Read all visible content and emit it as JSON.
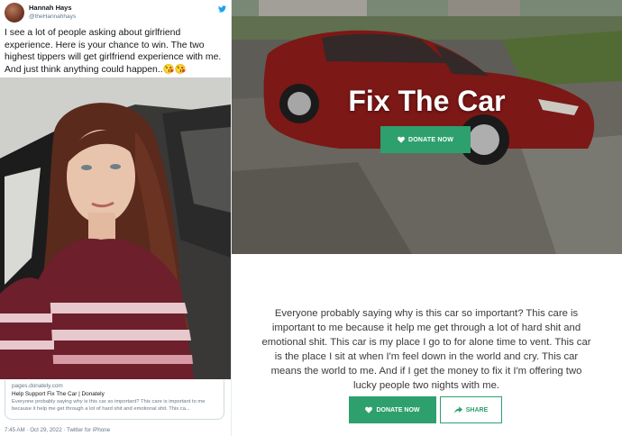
{
  "tweet": {
    "display_name": "Hannah Hays",
    "handle": "@theHannahhays",
    "text": "I see a lot of people asking about girlfriend experience. Here is your chance to win. The two highest tippers will get girlfriend experience with me. And just think anything could happen..😘😘",
    "card": {
      "domain": "pages.donately.com",
      "title": "Help Support Fix The Car | Donately",
      "description": "Everyone probably saying why is this car so important? This care is important to me because it help me get through a lot of hard shit and emotional shit. This ca..."
    },
    "meta": "7:45 AM · Oct 29, 2022 · Twitter for iPhone"
  },
  "donation": {
    "title": "Fix The Car",
    "hero_button": "DONATE NOW",
    "story": "Everyone probably saying why is this car so important? This care is important to me because it help me get through a lot of hard shit and emotional shit. This car is my place I go to for alone time to vent. This car is the place I sit at when I'm feel down in the world and cry. This car means the world to me. And if I get the money to fix it I'm offering two lucky people two nights with me.",
    "donate_button": "DONATE NOW",
    "share_button": "SHARE"
  },
  "colors": {
    "accent": "#2da06e",
    "twitter_blue": "#1da1f2"
  },
  "icons": [
    "twitter-logo-icon",
    "heart-icon",
    "share-icon"
  ]
}
